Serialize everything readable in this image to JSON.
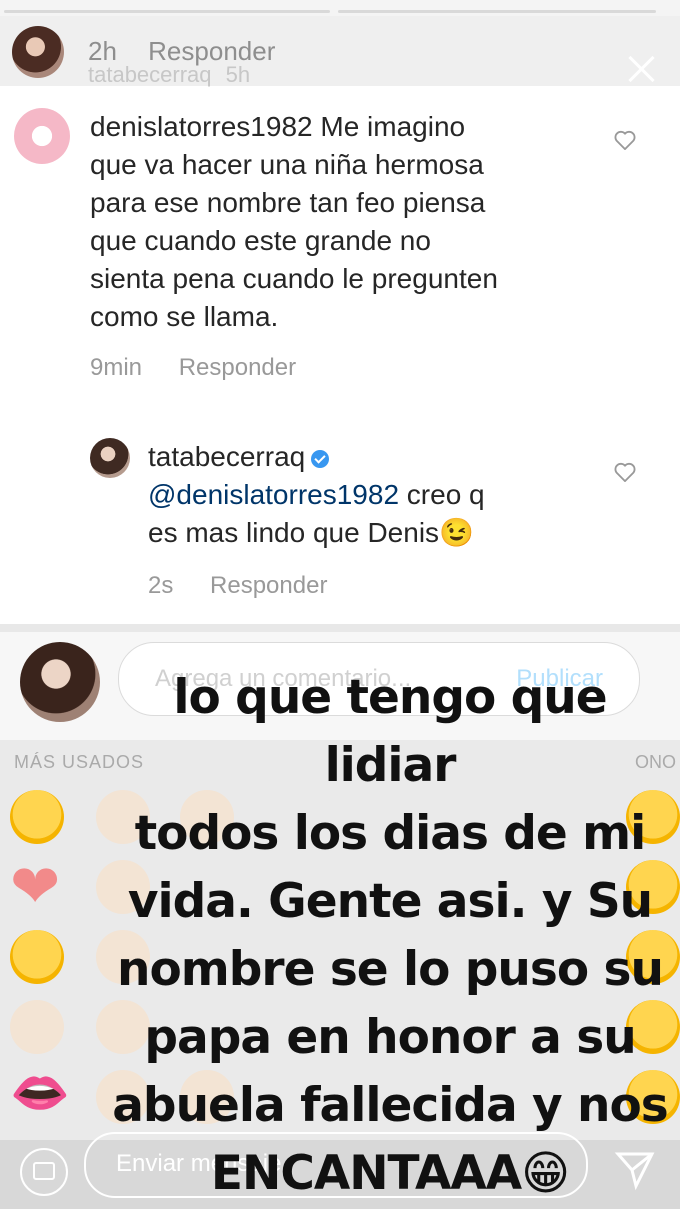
{
  "story": {
    "username": "tatabecerraq",
    "posted_ago": "5h"
  },
  "previous_comment": {
    "time": "2h",
    "reply_label": "Responder"
  },
  "comments": [
    {
      "username": "denislatorres1982",
      "text": "Me imagino que va hacer una niña hermosa para ese nombre tan feo piensa que cuando este grande no sienta pena cuando le pregunten como se llama.",
      "lines": [
        "denislatorres1982 Me imagino",
        "que va hacer una niña hermosa",
        "para ese nombre tan feo piensa",
        "que cuando este grande no",
        "sienta pena cuando le pregunten",
        "como se llama."
      ],
      "time": "9min",
      "reply_label": "Responder"
    },
    {
      "username": "tatabecerraq",
      "mention": "@denislatorres1982",
      "text_line1": " creo q",
      "text_line2": "es mas lindo que Denis",
      "emoji": "😉",
      "time": "2s",
      "reply_label": "Responder"
    }
  ],
  "comment_input": {
    "placeholder": "Agrega un comentario...",
    "post_label": "Publicar"
  },
  "emoji_panel": {
    "label_left": "MÁS USADOS",
    "label_right": "ONO"
  },
  "overlay_text": [
    "lo que tengo que lidiar",
    "todos los dias de mi",
    "vida. Gente asi. y Su",
    "nombre se lo puso su",
    "papa en honor a su",
    "abuela fallecida y nos",
    "ENCANTAAA😁"
  ],
  "message_input": {
    "placeholder": "Enviar mensaje"
  }
}
